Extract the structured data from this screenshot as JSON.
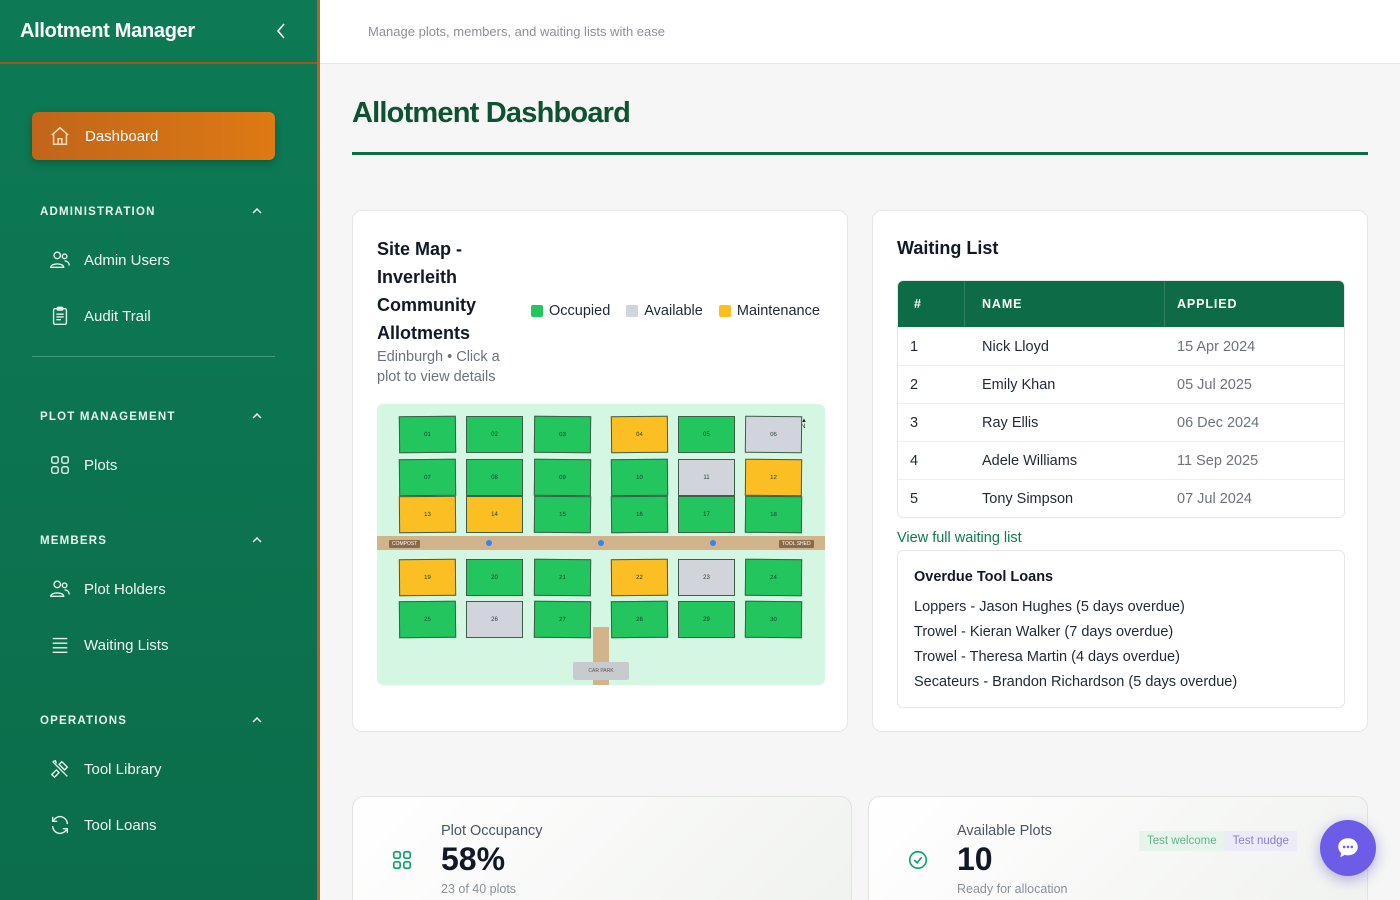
{
  "app": {
    "title": "Allotment Manager",
    "tagline": "Manage plots, members, and waiting lists with ease"
  },
  "sidebar": {
    "active": {
      "label": "Dashboard",
      "icon": "home-icon"
    },
    "sections": [
      {
        "title": "ADMINISTRATION",
        "items": [
          {
            "label": "Admin Users",
            "icon": "users-icon"
          },
          {
            "label": "Audit Trail",
            "icon": "clipboard-icon"
          }
        ]
      },
      {
        "title": "PLOT MANAGEMENT",
        "items": [
          {
            "label": "Plots",
            "icon": "grid-icon"
          }
        ]
      },
      {
        "title": "MEMBERS",
        "items": [
          {
            "label": "Plot Holders",
            "icon": "users-icon"
          },
          {
            "label": "Waiting Lists",
            "icon": "list-icon"
          }
        ]
      },
      {
        "title": "OPERATIONS",
        "items": [
          {
            "label": "Tool Library",
            "icon": "tools-icon"
          },
          {
            "label": "Tool Loans",
            "icon": "refresh-icon"
          }
        ]
      }
    ]
  },
  "page": {
    "title": "Allotment Dashboard"
  },
  "site_map": {
    "title": "Site Map - Inverleith Community Allotments",
    "subtitle": "Edinburgh • Click a plot to view details",
    "legend": [
      {
        "label": "Occupied",
        "color": "#22c55e"
      },
      {
        "label": "Available",
        "color": "#d1d5db"
      },
      {
        "label": "Maintenance",
        "color": "#fbbf24"
      }
    ],
    "labels": {
      "compost": "COMPOST",
      "tool_shed": "TOOL SHED",
      "car_park": "CAR PARK",
      "north": "N"
    },
    "plots": [
      {
        "id": "01",
        "status": "occupied"
      },
      {
        "id": "02",
        "status": "occupied"
      },
      {
        "id": "03",
        "status": "occupied"
      },
      {
        "id": "04",
        "status": "maintenance"
      },
      {
        "id": "05",
        "status": "occupied"
      },
      {
        "id": "06",
        "status": "available"
      },
      {
        "id": "07",
        "status": "occupied"
      },
      {
        "id": "08",
        "status": "occupied"
      },
      {
        "id": "09",
        "status": "occupied"
      },
      {
        "id": "10",
        "status": "occupied"
      },
      {
        "id": "11",
        "status": "available"
      },
      {
        "id": "12",
        "status": "maintenance"
      },
      {
        "id": "13",
        "status": "maintenance"
      },
      {
        "id": "14",
        "status": "maintenance"
      },
      {
        "id": "15",
        "status": "occupied"
      },
      {
        "id": "16",
        "status": "occupied"
      },
      {
        "id": "17",
        "status": "occupied"
      },
      {
        "id": "18",
        "status": "occupied"
      },
      {
        "id": "19",
        "status": "maintenance"
      },
      {
        "id": "20",
        "status": "occupied"
      },
      {
        "id": "21",
        "status": "occupied"
      },
      {
        "id": "22",
        "status": "maintenance"
      },
      {
        "id": "23",
        "status": "available"
      },
      {
        "id": "24",
        "status": "occupied"
      },
      {
        "id": "25",
        "status": "occupied"
      },
      {
        "id": "26",
        "status": "available"
      },
      {
        "id": "27",
        "status": "occupied"
      },
      {
        "id": "28",
        "status": "occupied"
      },
      {
        "id": "29",
        "status": "occupied"
      },
      {
        "id": "30",
        "status": "occupied"
      }
    ]
  },
  "waiting_list": {
    "title": "Waiting List",
    "columns": [
      "#",
      "NAME",
      "APPLIED"
    ],
    "rows": [
      {
        "n": "1",
        "name": "Nick Lloyd",
        "applied": "15 Apr 2024"
      },
      {
        "n": "2",
        "name": "Emily Khan",
        "applied": "05 Jul 2025"
      },
      {
        "n": "3",
        "name": "Ray Ellis",
        "applied": "06 Dec 2024"
      },
      {
        "n": "4",
        "name": "Adele Williams",
        "applied": "11 Sep 2025"
      },
      {
        "n": "5",
        "name": "Tony Simpson",
        "applied": "07 Jul 2024"
      }
    ],
    "view_link": "View full waiting list"
  },
  "overdue": {
    "title": "Overdue Tool Loans",
    "items": [
      "Loppers - Jason Hughes (5 days overdue)",
      "Trowel - Kieran Walker (7 days overdue)",
      "Trowel - Theresa Martin (4 days overdue)",
      "Secateurs - Brandon Richardson (5 days overdue)"
    ]
  },
  "stats": {
    "occupancy": {
      "label": "Plot Occupancy",
      "value": "58%",
      "note": "23 of 40 plots",
      "icon": "grid-icon"
    },
    "available": {
      "label": "Available Plots",
      "value": "10",
      "note": "Ready for allocation",
      "icon": "check-circle-icon"
    },
    "test_buttons": [
      "Test welcome",
      "Test nudge"
    ]
  },
  "colors": {
    "sidebar": "#0b6d4b",
    "accent": "#dd7a14",
    "primary_dark": "#0f5132",
    "chat": "#6d5ce8"
  }
}
